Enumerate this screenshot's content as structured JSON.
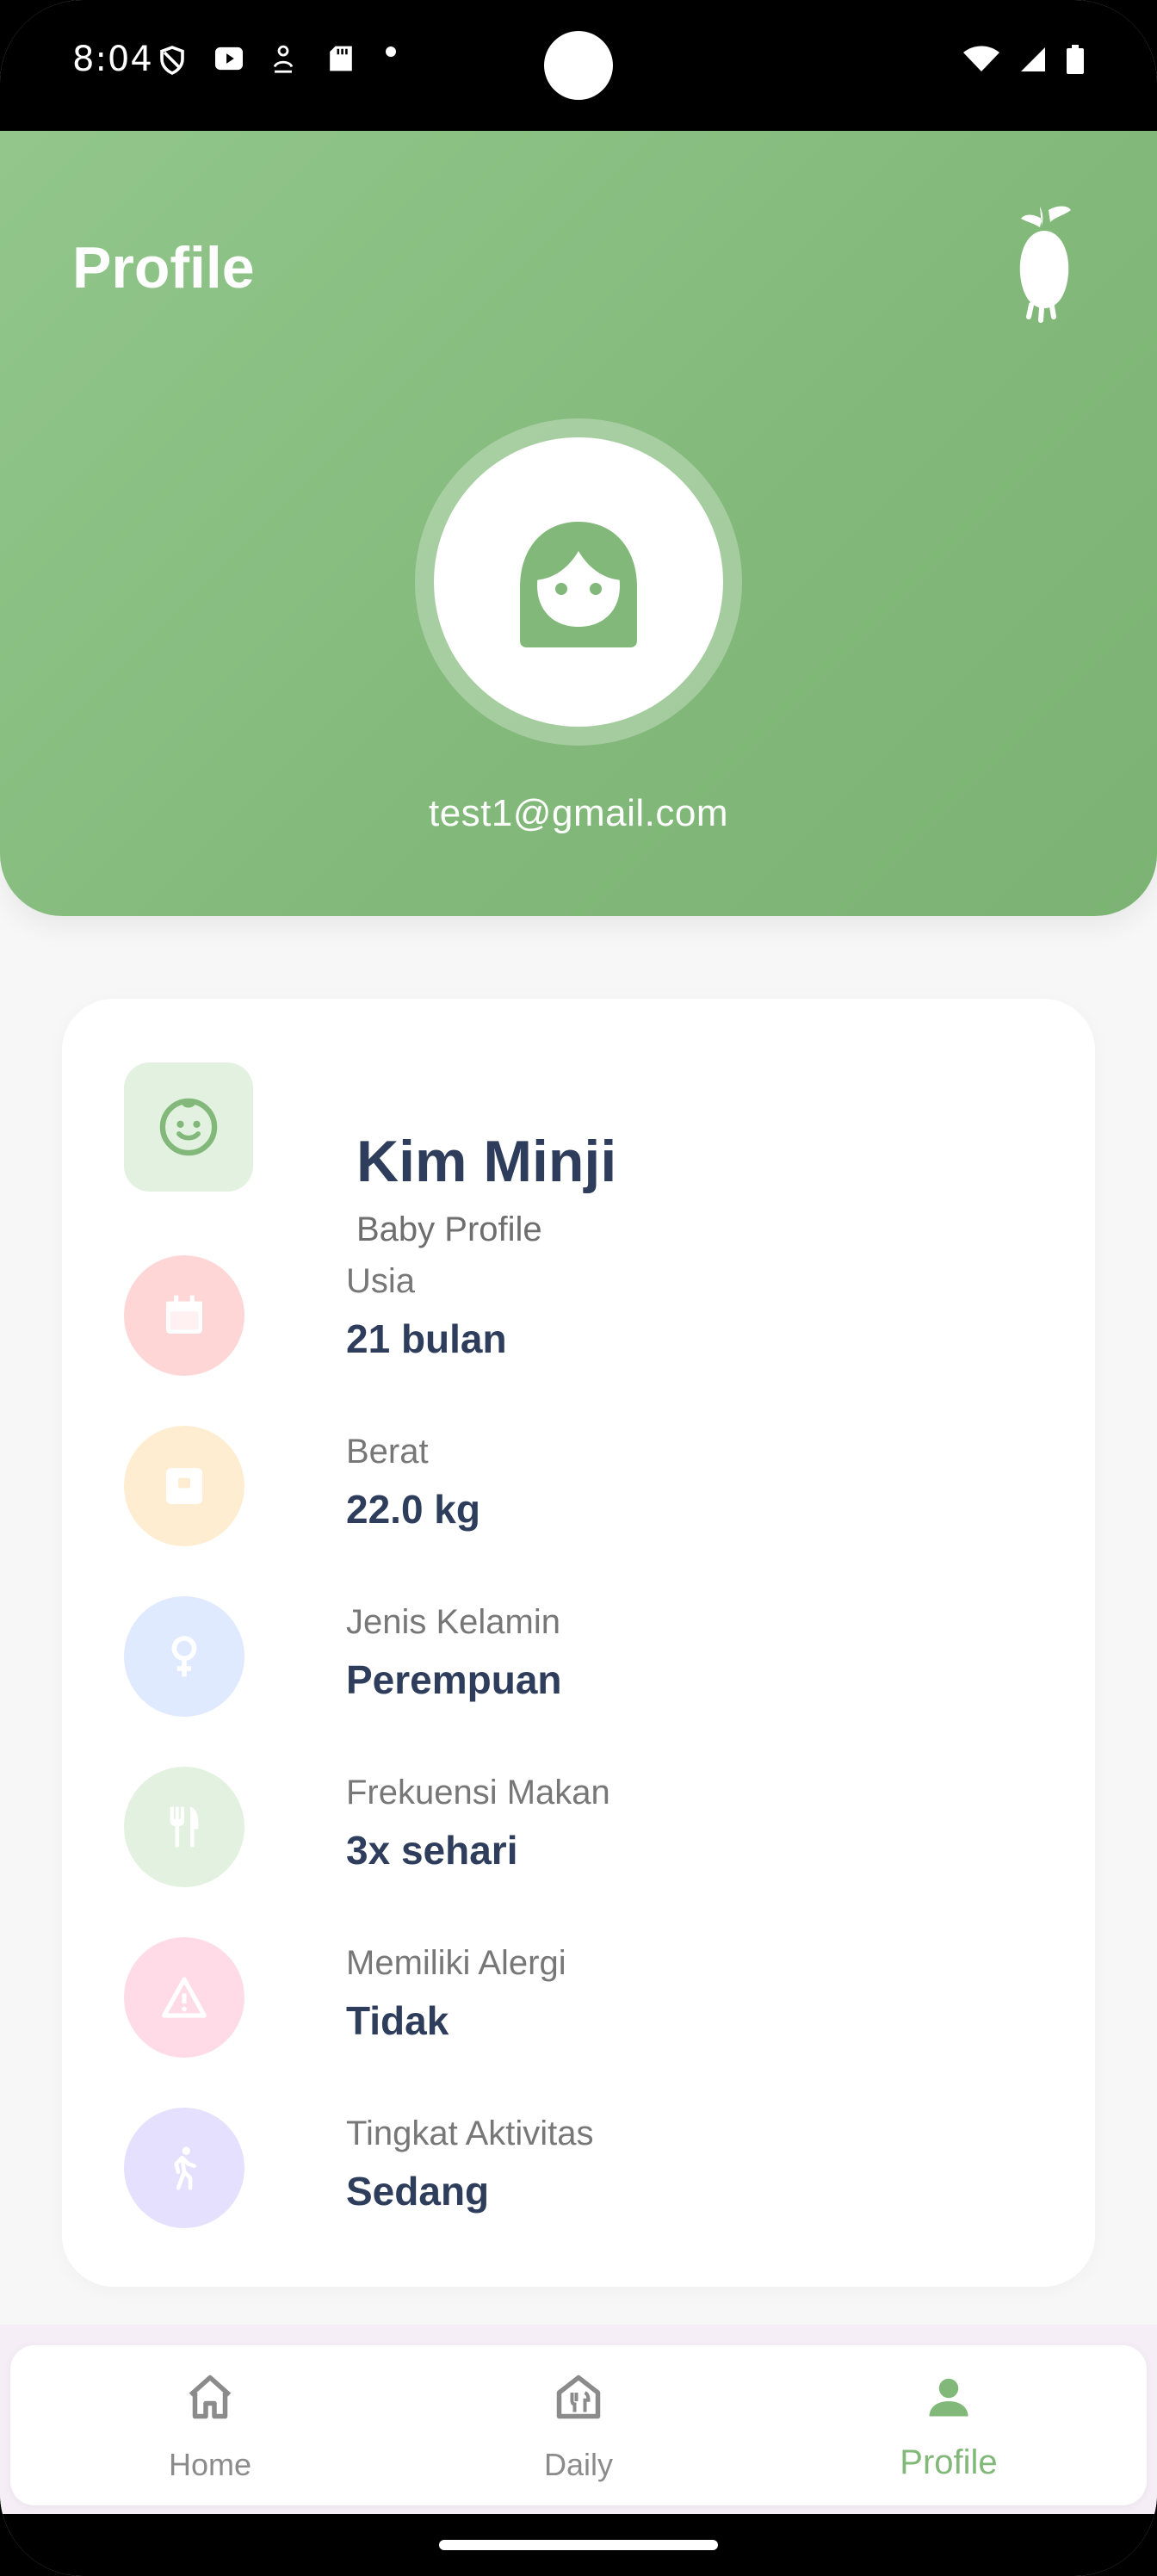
{
  "status_bar": {
    "time": "8:04",
    "left_icons": [
      "shield-icon",
      "play-icon",
      "accessibility-icon",
      "sd-card-icon",
      "dot-icon"
    ],
    "right_icons": [
      "wifi-icon",
      "signal-icon",
      "battery-icon"
    ]
  },
  "header": {
    "title": "Profile",
    "email": "test1@gmail.com",
    "logo_icon": "radish-logo-icon",
    "avatar_icon": "girl-avatar-icon",
    "colors": {
      "gradient_start": "#92c68b",
      "gradient_end": "#7cb374"
    }
  },
  "profile_card": {
    "name": "Kim Minji",
    "subtitle": "Baby Profile",
    "icon": "baby-face-icon",
    "rows": [
      {
        "label": "Usia",
        "value": "21 bulan",
        "icon": "calendar-icon",
        "color": "#ffd6d6",
        "icon_color": "#ffffff"
      },
      {
        "label": "Berat",
        "value": "22.0 kg",
        "icon": "scale-icon",
        "color": "#ffedd2",
        "icon_color": "#ffffff"
      },
      {
        "label": "Jenis Kelamin",
        "value": "Perempuan",
        "icon": "female-icon",
        "color": "#dfe9ff",
        "icon_color": "#ffffff"
      },
      {
        "label": "Frekuensi Makan",
        "value": "3x sehari",
        "icon": "fork-knife-icon",
        "color": "#e3f1e0",
        "icon_color": "#ffffff"
      },
      {
        "label": "Memiliki Alergi",
        "value": "Tidak",
        "icon": "warning-icon",
        "color": "#ffdbe8",
        "icon_color": "#ffffff"
      },
      {
        "label": "Tingkat Aktivitas",
        "value": "Sedang",
        "icon": "walking-icon",
        "color": "#e6e0ff",
        "icon_color": "#ffffff"
      }
    ]
  },
  "bottom_nav": {
    "items": [
      {
        "label": "Home",
        "icon": "home-icon",
        "active": false
      },
      {
        "label": "Daily",
        "icon": "daily-meal-icon",
        "active": false
      },
      {
        "label": "Profile",
        "icon": "person-icon",
        "active": true
      }
    ],
    "active_color": "#82b97a",
    "inactive_color": "#8b8b8b"
  }
}
